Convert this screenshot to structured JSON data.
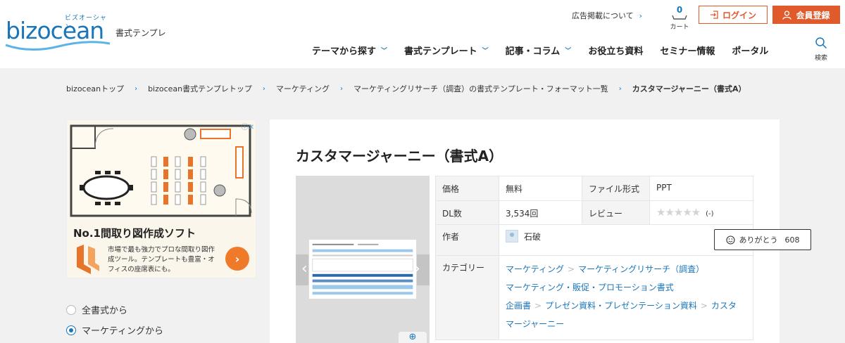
{
  "header": {
    "logo_kana": "ビズオーシャン",
    "logo_text": "bizocean",
    "site_subtitle": "書式テンプレ",
    "ad_link": "広告掲載について",
    "cart_count": "0",
    "cart_label": "カート",
    "login_label": "ログイン",
    "register_label": "会員登録",
    "search_label": "検索"
  },
  "gnav": [
    {
      "label": "テーマから探す",
      "dropdown": true
    },
    {
      "label": "書式テンプレート",
      "dropdown": true
    },
    {
      "label": "記事・コラム",
      "dropdown": true
    },
    {
      "label": "お役立ち資料",
      "dropdown": false
    },
    {
      "label": "セミナー情報",
      "dropdown": false
    },
    {
      "label": "ポータル",
      "dropdown": false
    }
  ],
  "breadcrumb": [
    "bizoceanトップ",
    "bizocean書式テンプレトップ",
    "マーケティング",
    "マーケティングリサーチ（調査）の書式テンプレート・フォーマット一覧",
    "カスタマージャーニー（書式A）"
  ],
  "ad": {
    "title": "No.1間取り図作成ソフト",
    "body": "市場で最も強力でプロな間取り図作成ツール。テンプレートも豊富・オフィスの座席表にも。"
  },
  "filters": [
    {
      "label": "全書式から",
      "selected": false
    },
    {
      "label": "マーケティングから",
      "selected": true
    }
  ],
  "document": {
    "title": "カスタマージャーニー（書式A）",
    "price_label": "価格",
    "price": "無料",
    "format_label": "ファイル形式",
    "format": "PPT",
    "downloads_label": "DL数",
    "downloads": "3,534回",
    "review_label": "レビュー",
    "review_count": "(-)",
    "rating": 0,
    "author_label": "作者",
    "author": "石破",
    "thanks_label": "ありがとう",
    "thanks_count": "608",
    "category_label": "カテゴリー",
    "categories": [
      [
        "マーケティング",
        "マーケティングリサーチ（調査）"
      ],
      [
        "マーケティング・販促・プロモーション書式"
      ],
      [
        "企画書",
        "プレゼン資料・プレゼンテーション資料",
        "カスタマージャーニー"
      ]
    ]
  },
  "colors": {
    "brand": "#1a76b8",
    "accent": "#e05a2b"
  }
}
